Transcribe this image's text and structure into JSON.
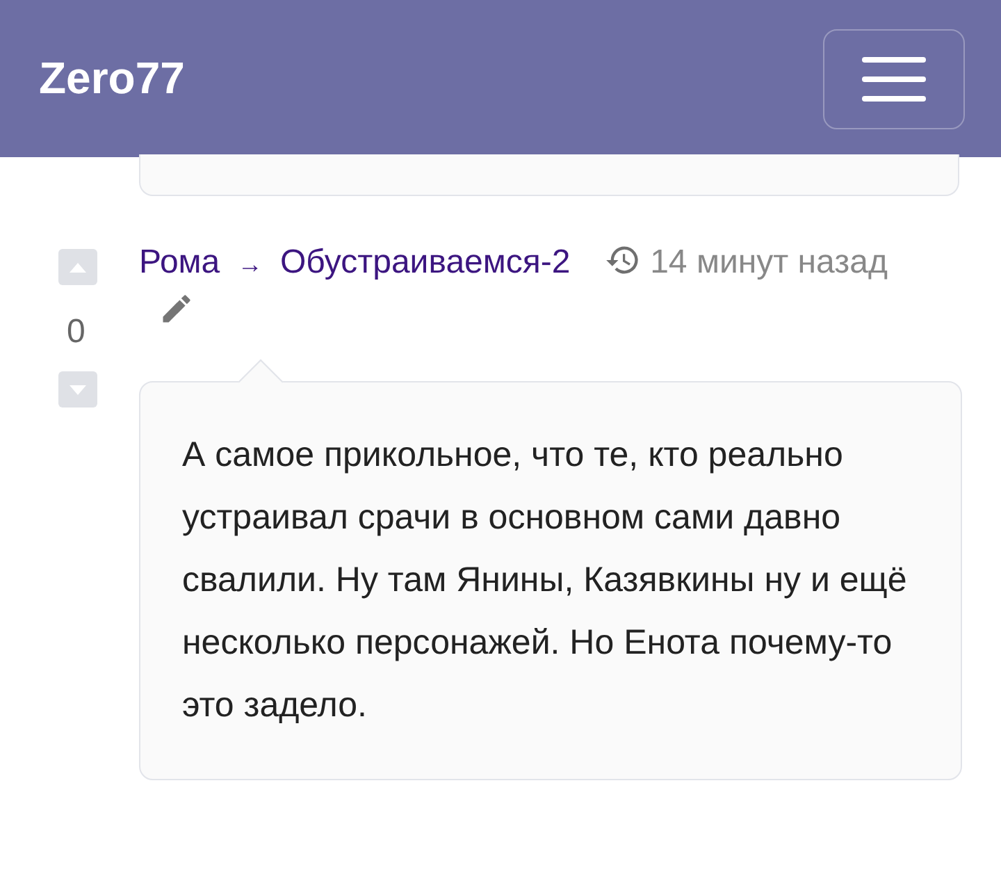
{
  "header": {
    "brand": "Zero77"
  },
  "comment": {
    "score": "0",
    "author": "Рома",
    "arrow": "→",
    "topic": "Обустраиваемся-2",
    "time": "14 минут назад",
    "text": "А самое прикольное, что те, кто реально устраивал срачи в основном сами давно свалили. Ну там Янины, Казявкины ну и ещё несколько персонажей. Но Енота почему-то это задело."
  }
}
